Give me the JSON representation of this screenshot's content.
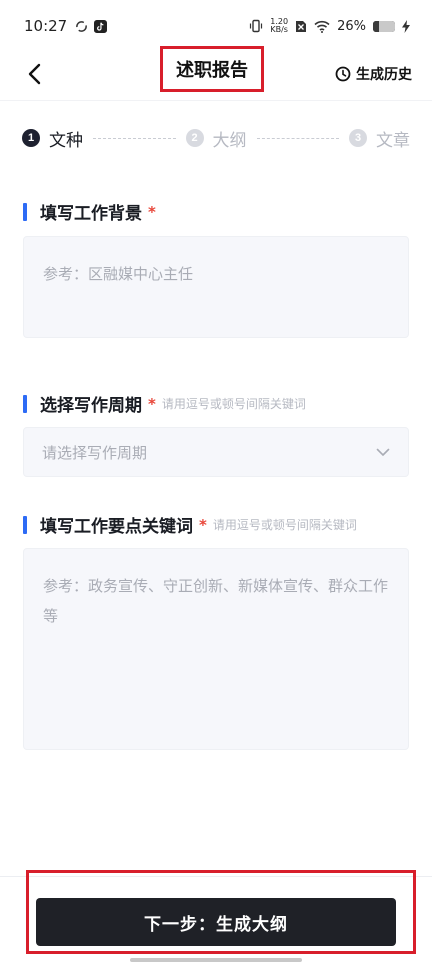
{
  "status_bar": {
    "time": "10:27",
    "net_speed_value": "1.20",
    "net_speed_unit": "KB/s",
    "battery_percent": "26%",
    "battery_level": 0.26,
    "icons": [
      "sync-icon",
      "tiktok-icon",
      "vibrate-icon",
      "sim-off-icon",
      "wifi-icon",
      "battery-icon",
      "charging-icon"
    ]
  },
  "nav": {
    "title": "述职报告",
    "history_label": "生成历史",
    "back_icon": "chevron-left-icon",
    "history_icon": "clock-icon",
    "highlight_color": "#d81e2b"
  },
  "stepper": {
    "steps": [
      {
        "num": "1",
        "label": "文种",
        "state": "active"
      },
      {
        "num": "2",
        "label": "大纲",
        "state": "inactive"
      },
      {
        "num": "3",
        "label": "文章",
        "state": "inactive"
      }
    ]
  },
  "form": {
    "background": {
      "label": "填写工作背景",
      "required": "*",
      "placeholder": "参考：区融媒中心主任"
    },
    "period": {
      "label": "选择写作周期",
      "required": "*",
      "hint": "请用逗号或顿号间隔关键词",
      "placeholder": "请选择写作周期"
    },
    "keywords": {
      "label": "填写工作要点关键词",
      "required": "*",
      "hint": "请用逗号或顿号间隔关键词",
      "placeholder": "参考：政务宣传、守正创新、新媒体宣传、群众工作等"
    }
  },
  "footer": {
    "next_label": "下一步：生成大纲"
  },
  "colors": {
    "accent": "#2d6bf5",
    "required": "#e8463a",
    "primary_button": "#1f2127",
    "highlight": "#d81e2b"
  }
}
